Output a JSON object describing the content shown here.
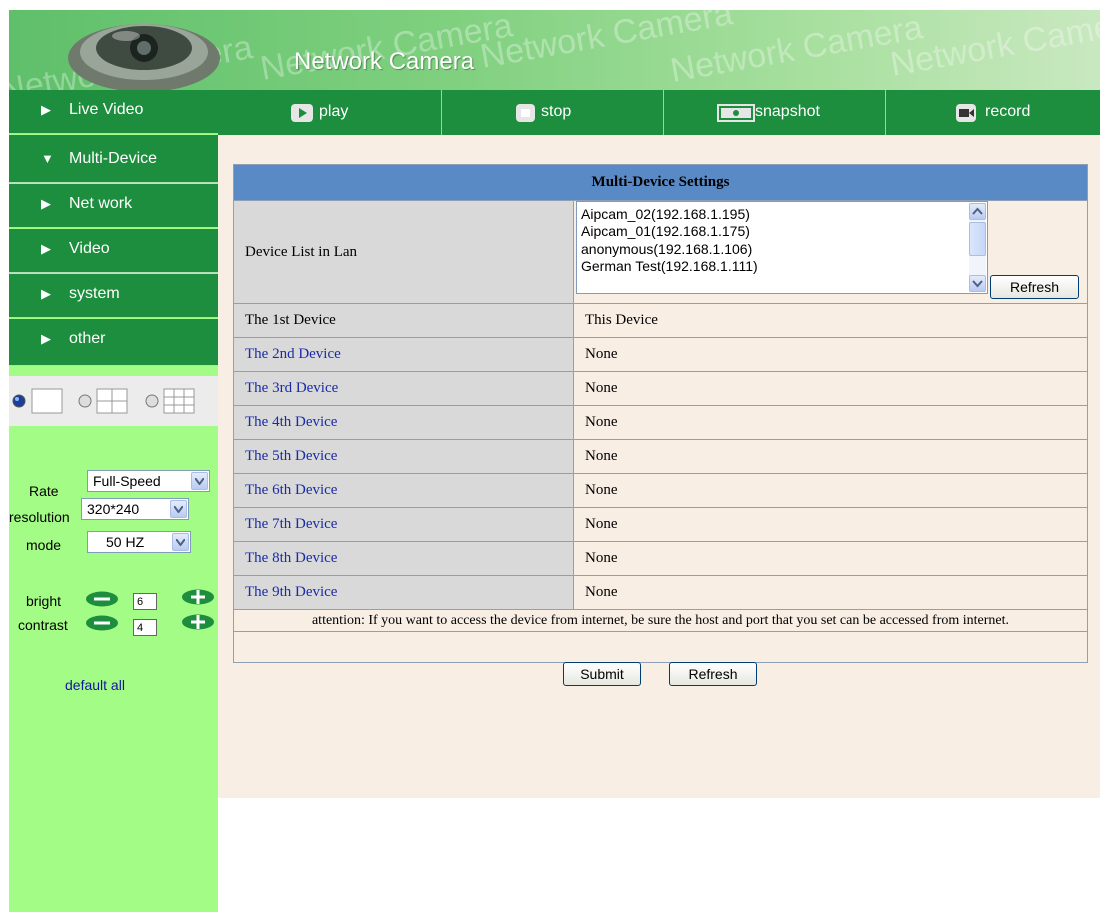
{
  "header": {
    "title": "Network Camera",
    "watermark": "Network Camera",
    "logo_icon": "dome-camera-icon",
    "colors": {
      "header_start": "#5fbf6a",
      "header_end": "#c9e8c0"
    }
  },
  "sidebar": {
    "menu": [
      {
        "label": "Live Video",
        "icon": "triangle-right-icon",
        "expanded": false
      },
      {
        "label": "Multi-Device",
        "icon": "triangle-down-icon",
        "expanded": true
      },
      {
        "label": "Net work",
        "icon": "triangle-right-icon",
        "expanded": false
      },
      {
        "label": "Video",
        "icon": "triangle-right-icon",
        "expanded": false
      },
      {
        "label": "system",
        "icon": "triangle-right-icon",
        "expanded": false
      },
      {
        "label": "other",
        "icon": "triangle-right-icon",
        "expanded": false
      }
    ],
    "layout_options": [
      "single-view-icon",
      "quad-view-icon",
      "nine-view-icon"
    ],
    "layout_selected": 0,
    "controls": {
      "rate": {
        "label": "Rate",
        "value": "Full-Speed"
      },
      "resolution": {
        "label": "resolution",
        "value": "320*240"
      },
      "mode": {
        "label": "mode",
        "value": "50 HZ"
      },
      "bright": {
        "label": "bright",
        "value": "6"
      },
      "contrast": {
        "label": "contrast",
        "value": "4"
      }
    },
    "default_all": "default all",
    "colors": {
      "nav_bg": "#1d8d3e",
      "panel_bg": "#a3fc86"
    }
  },
  "toolbar": {
    "play": "play",
    "stop": "stop",
    "snapshot": "snapshot",
    "record": "record"
  },
  "settings": {
    "title": "Multi-Device Settings",
    "device_list_label": "Device List in Lan",
    "device_list": [
      "Aipcam_02(192.168.1.195)",
      "Aipcam_01(192.168.1.175)",
      "anonymous(192.168.1.106)",
      "German Test(192.168.1.111)"
    ],
    "list_refresh": "Refresh",
    "devices": [
      {
        "label": "The 1st Device",
        "value": "This Device",
        "link": false
      },
      {
        "label": "The 2nd Device",
        "value": "None",
        "link": true
      },
      {
        "label": "The 3rd Device",
        "value": "None",
        "link": true
      },
      {
        "label": "The 4th Device",
        "value": "None",
        "link": true
      },
      {
        "label": "The 5th Device",
        "value": "None",
        "link": true
      },
      {
        "label": "The 6th Device",
        "value": "None",
        "link": true
      },
      {
        "label": "The 7th Device",
        "value": "None",
        "link": true
      },
      {
        "label": "The 8th Device",
        "value": "None",
        "link": true
      },
      {
        "label": "The 9th Device",
        "value": "None",
        "link": true
      }
    ],
    "attention": "attention: If you want to access the device from internet, be sure the host and port that you set can be accessed from internet.",
    "submit": "Submit",
    "refresh": "Refresh",
    "colors": {
      "title_bg": "#5a8ac5",
      "label_bg": "#d9d9d9",
      "panel_bg": "#f8eee4",
      "link": "#1a2ba8"
    }
  }
}
